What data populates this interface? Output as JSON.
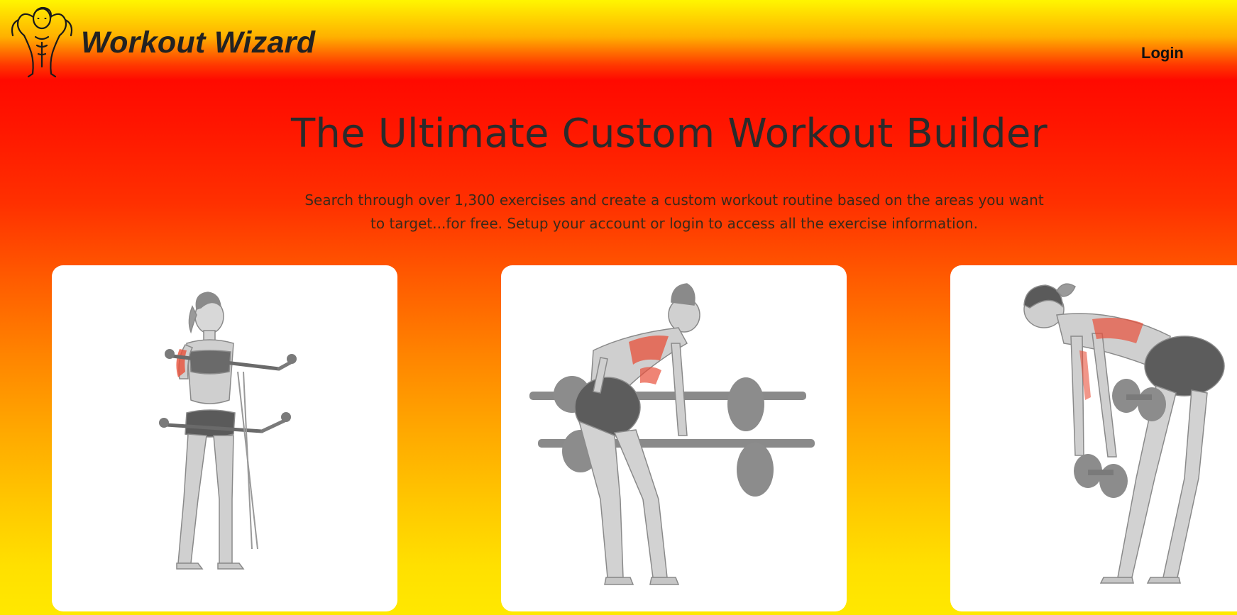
{
  "header": {
    "brand_name": "Workout Wizard",
    "logo_icon": "muscular-figure-logo-icon",
    "login_label": "Login"
  },
  "hero": {
    "title": "The Ultimate Custom Workout Builder",
    "subtitle_line1": "Search through over 1,300 exercises and create a custom workout routine based on the areas you want",
    "subtitle_line2": "to target...for free. Setup your account or login to access all the exercise information."
  },
  "cards": [
    {
      "illustration": "band-bicep-curl-illustration"
    },
    {
      "illustration": "barbell-bent-over-row-illustration"
    },
    {
      "illustration": "dumbbell-bent-over-row-illustration"
    }
  ],
  "colors": {
    "gradient_top": "#fff600",
    "gradient_red": "#ff0a00",
    "gradient_bottom": "#ffe800",
    "card_bg": "#ffffff",
    "muscle_highlight": "#e8503a"
  }
}
